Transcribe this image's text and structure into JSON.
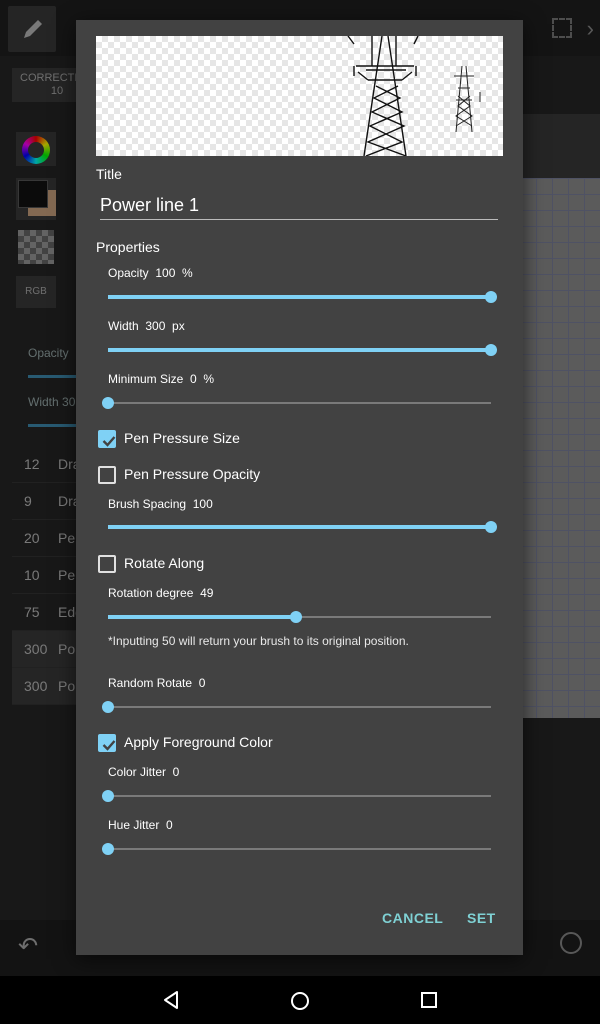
{
  "background": {
    "correction_label": "CORRECTION",
    "correction_value": "10",
    "rgb_label": "RGB",
    "opacity_label": "Opacity",
    "width_label": "Width",
    "width_value_partial": "30",
    "brush_list": [
      {
        "size": "12",
        "name": "Dra"
      },
      {
        "size": "9",
        "name": "Dra"
      },
      {
        "size": "20",
        "name": "Pen"
      },
      {
        "size": "10",
        "name": "Pen"
      },
      {
        "size": "75",
        "name": "Edg"
      },
      {
        "size": "300",
        "name": "Po"
      },
      {
        "size": "300",
        "name": "Po"
      }
    ]
  },
  "dialog": {
    "title_label": "Title",
    "title_value": "Power line 1",
    "properties_label": "Properties",
    "opacity": {
      "label": "Opacity  100  %",
      "value": 100,
      "max": 100
    },
    "width": {
      "label": "Width  300  px",
      "value": 300,
      "max": 300
    },
    "min_size": {
      "label": "Minimum Size  0  %",
      "value": 0,
      "max": 100
    },
    "pen_pressure_size": {
      "label": "Pen Pressure Size",
      "checked": true
    },
    "pen_pressure_opacity": {
      "label": "Pen Pressure Opacity",
      "checked": false
    },
    "brush_spacing": {
      "label": "Brush Spacing  100",
      "value": 100,
      "max": 100
    },
    "rotate_along": {
      "label": "Rotate Along",
      "checked": false
    },
    "rotation_degree": {
      "label": "Rotation degree  49",
      "value": 49,
      "max": 100
    },
    "rotation_note": "*Inputting 50 will return your brush to its original position.",
    "random_rotate": {
      "label": "Random Rotate  0",
      "value": 0,
      "max": 100
    },
    "apply_fg_color": {
      "label": "Apply Foreground Color",
      "checked": true
    },
    "color_jitter": {
      "label": "Color Jitter  0",
      "value": 0,
      "max": 100
    },
    "hue_jitter": {
      "label": "Hue Jitter  0",
      "value": 0,
      "max": 100
    },
    "cancel_label": "CANCEL",
    "set_label": "SET"
  },
  "colors": {
    "accent": "#7fd1f5",
    "dialog_bg": "#424242",
    "button_text": "#7fd1d4"
  },
  "icons": [
    "pen-icon",
    "undo-icon",
    "more-icon",
    "back-icon",
    "home-icon",
    "recent-apps-icon",
    "checkmark-icon"
  ]
}
